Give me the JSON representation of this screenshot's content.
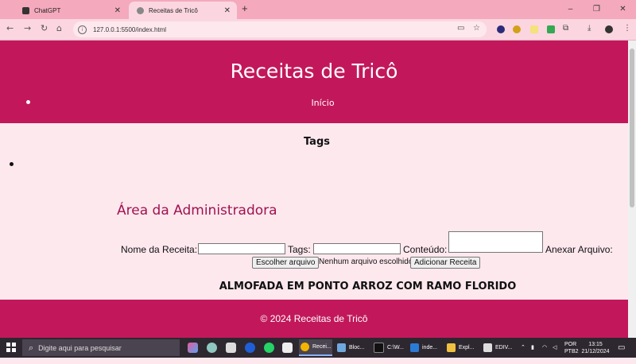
{
  "browser": {
    "tabs": [
      {
        "title": "ChatGPT",
        "favicon_color": "#333333"
      },
      {
        "title": "Receitas de Tricô",
        "favicon_color": "#888888",
        "active": true
      }
    ],
    "url": "127.0.0.1:5500/index.html",
    "win_controls": {
      "minimize": "–",
      "maximize": "❐",
      "close": "✕"
    }
  },
  "site": {
    "title": "Receitas de Tricô",
    "nav_items": [
      "Início"
    ],
    "tags_heading": "Tags",
    "admin_heading": "Área da Administradora",
    "form": {
      "recipe_name_label": "Nome da Receita:",
      "tags_label": "Tags:",
      "content_label": "Conteúdo:",
      "attach_label": "Anexar Arquivo:",
      "choose_file_button": "Escolher arquivo",
      "no_file_text": "Nenhum arquivo escolhido",
      "add_button": "Adicionar Receita"
    },
    "recipe_title": "ALMOFADA EM PONTO ARROZ COM RAMO FLORIDO",
    "footer": "© 2024 Receitas de Tricô",
    "colors": {
      "primary": "#c2185b",
      "background": "#fde8ee",
      "admin_heading": "#a0124f"
    }
  },
  "taskbar": {
    "search_placeholder": "Digite aqui para pesquisar",
    "apps": [
      {
        "label": "Recei...",
        "color": "#f4b400"
      },
      {
        "label": "Bloc...",
        "color": "#6fa8dc"
      },
      {
        "label": "C:\\W...",
        "color": "#222222"
      },
      {
        "label": "inde...",
        "color": "#2b7bd6"
      },
      {
        "label": "Expl...",
        "color": "#f0c040"
      },
      {
        "label": "EDIV...",
        "color": "#dddddd"
      }
    ],
    "language": "POR",
    "layout": "PTB2",
    "time": "13:15",
    "date": "21/12/2024"
  }
}
